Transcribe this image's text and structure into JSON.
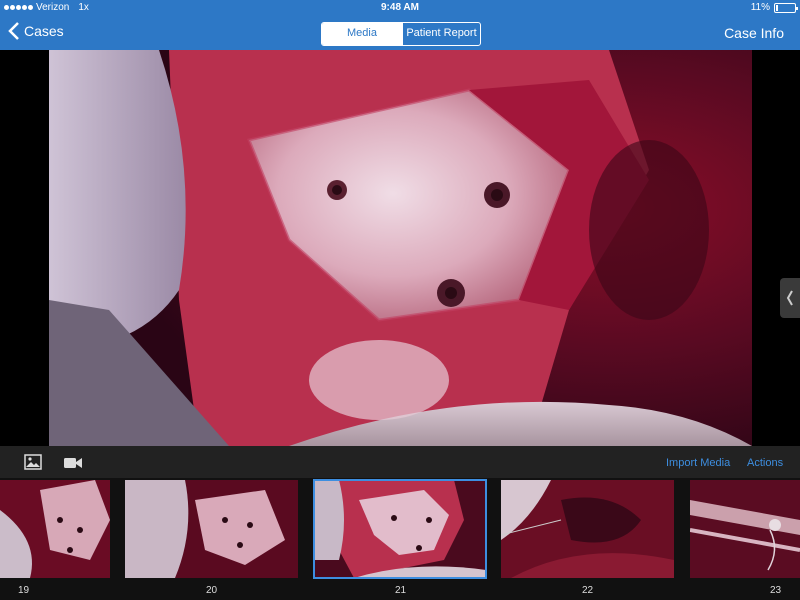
{
  "status": {
    "carrier": "Verizon",
    "network": "1x",
    "time": "9:48 AM",
    "battery": "11%",
    "battery_level": 0.11
  },
  "nav": {
    "back_label": "Cases",
    "segments": [
      "Media",
      "Patient Report"
    ],
    "selected_segment": "Media",
    "right_label": "Case Info"
  },
  "toolbar": {
    "photo_icon": "photo-icon",
    "video_icon": "video-camera-icon",
    "import_label": "Import Media",
    "actions_label": "Actions"
  },
  "thumbnails": [
    {
      "label": "19",
      "selected": false
    },
    {
      "label": "20",
      "selected": false
    },
    {
      "label": "21",
      "selected": true
    },
    {
      "label": "22",
      "selected": false
    },
    {
      "label": "23",
      "selected": false
    }
  ],
  "colors": {
    "accent": "#2d78c6",
    "link": "#3d8ee0",
    "toolbar_bg": "#222222"
  }
}
